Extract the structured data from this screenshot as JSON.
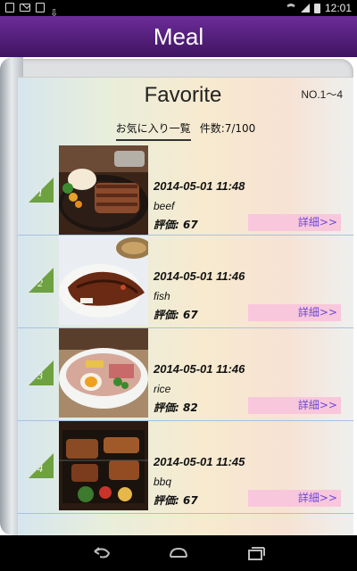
{
  "status": {
    "time": "12:01"
  },
  "header": {
    "title": "Meal"
  },
  "page": {
    "title": "Favorite",
    "page_no": "NO.1～4",
    "tab_label": "お気に入り一覧",
    "count_label": "件数:7/100"
  },
  "items": [
    {
      "rank": "1",
      "datetime": "2014-05-01 11:48",
      "category": "beef",
      "score": "評価: 67",
      "detail": "詳細>>"
    },
    {
      "rank": "2",
      "datetime": "2014-05-01 11:46",
      "category": "fish",
      "score": "評価: 67",
      "detail": "詳細>>"
    },
    {
      "rank": "3",
      "datetime": "2014-05-01 11:46",
      "category": "rice",
      "score": "評価: 82",
      "detail": "詳細>>"
    },
    {
      "rank": "4",
      "datetime": "2014-05-01 11:45",
      "category": "bbq",
      "score": "評価: 67",
      "detail": "詳細>>"
    }
  ],
  "colors": {
    "header_top": "#6c2c99",
    "header_bottom": "#3f1460",
    "rank_triangle": "#6ea13f",
    "detail_button_bg": "#f9c7dc",
    "detail_button_text": "#6b48d6",
    "row_divider": "#a7c1e2"
  },
  "icons": [
    "image-icon",
    "mail-icon",
    "photo-icon",
    "download-icon",
    "wifi-icon",
    "signal-icon",
    "battery-icon",
    "back-icon",
    "home-icon",
    "recent-apps-icon"
  ]
}
